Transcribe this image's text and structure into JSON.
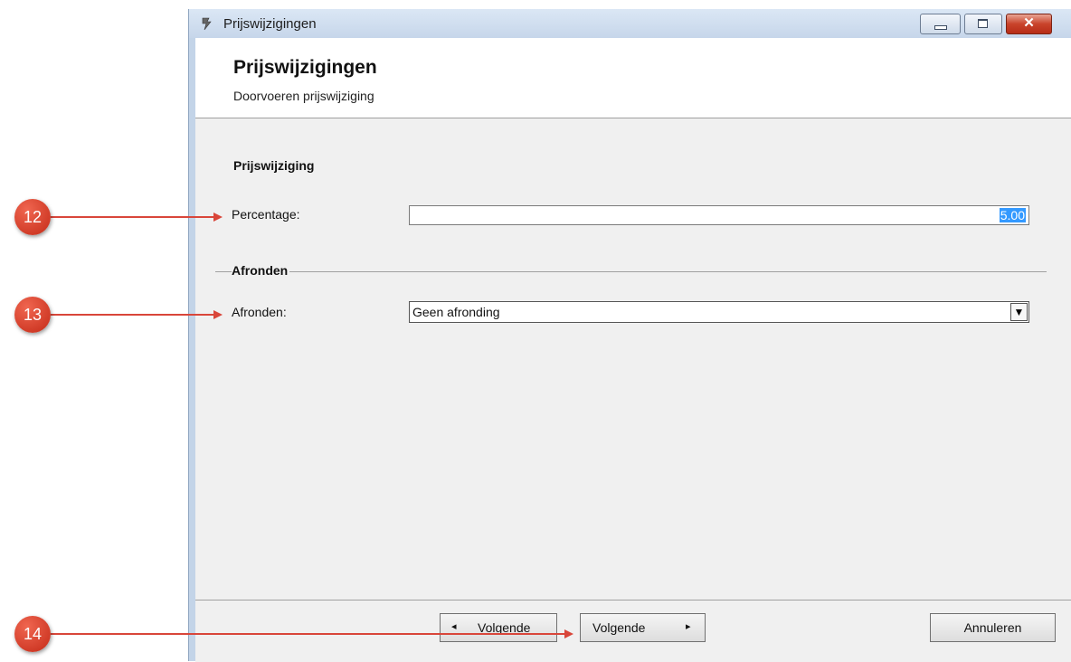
{
  "window": {
    "title": "Prijswijzigingen",
    "icon": "app-logo-icon",
    "controls": {
      "minimize": "minimize-icon",
      "maximize": "maximize-icon",
      "close": "✕"
    }
  },
  "header": {
    "title": "Prijswijzigingen",
    "subtitle": "Doorvoeren prijswijziging"
  },
  "sections": {
    "prijswijziging": {
      "title": "Prijswijziging",
      "percentage_label": "Percentage:",
      "percentage_value": "5.00"
    },
    "afronden": {
      "title": "Afronden",
      "afronden_label": "Afronden:",
      "afronden_value": "Geen afronding",
      "dropdown_arrow": "▼"
    }
  },
  "footer": {
    "prev_arrow": "◂",
    "prev_label": "Volgende",
    "next_label": "Volgende",
    "next_arrow": "▸",
    "cancel_label": "Annuleren"
  },
  "annotations": {
    "marker_12": "12",
    "marker_13": "13",
    "marker_14": "14",
    "color": "#d9463a"
  }
}
